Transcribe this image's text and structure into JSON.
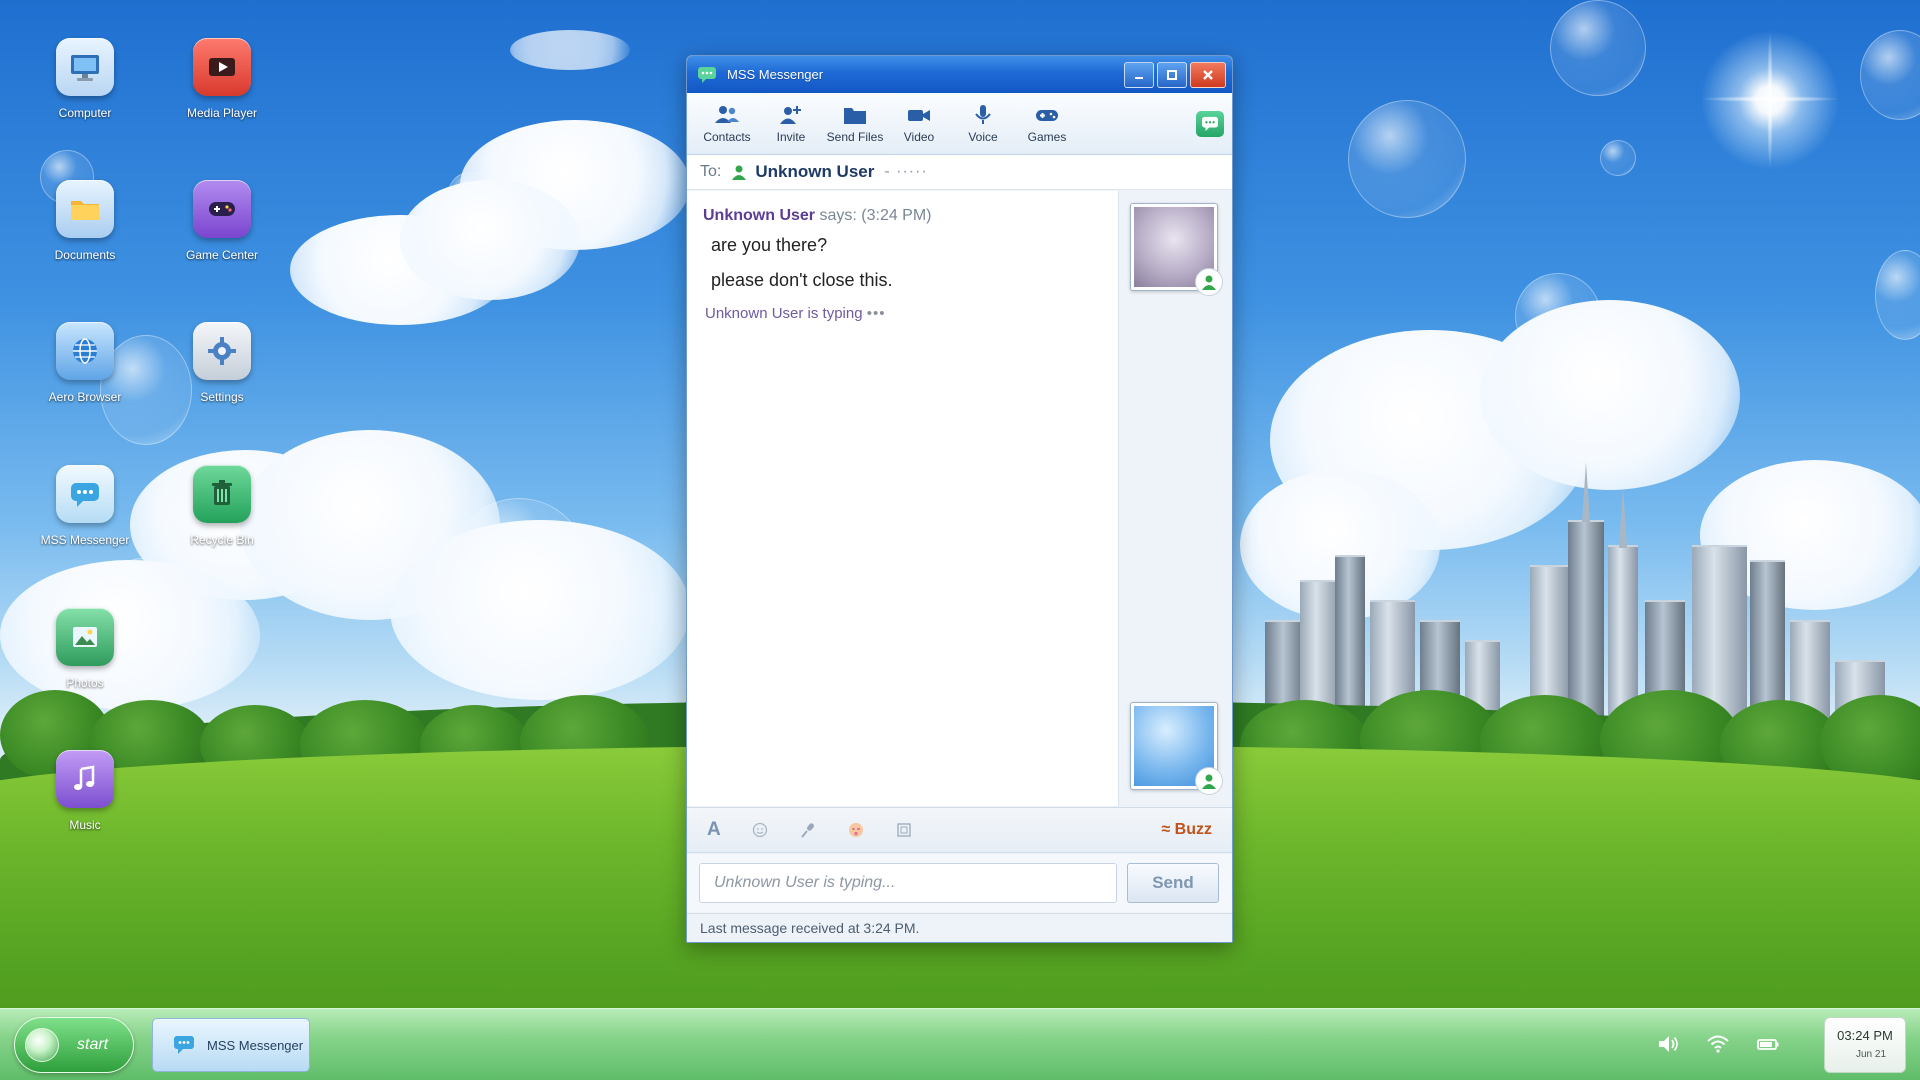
{
  "desktop": {
    "icons": [
      {
        "label": "Computer",
        "icon": "computer-icon"
      },
      {
        "label": "Media Player",
        "icon": "media-player-icon"
      },
      {
        "label": "Documents",
        "icon": "folder-icon"
      },
      {
        "label": "Game Center",
        "icon": "gamepad-icon"
      },
      {
        "label": "Aero Browser",
        "icon": "globe-icon"
      },
      {
        "label": "Settings",
        "icon": "gear-icon"
      },
      {
        "label": "MSS Messenger",
        "icon": "chat-icon"
      },
      {
        "label": "Recycle Bin",
        "icon": "trash-icon"
      },
      {
        "label": "Photos",
        "icon": "photo-icon"
      },
      {
        "label": "Music",
        "icon": "music-note-icon"
      }
    ]
  },
  "window": {
    "title": "MSS Messenger",
    "toolbar": [
      {
        "label": "Contacts",
        "icon": "contacts-icon"
      },
      {
        "label": "Invite",
        "icon": "invite-user-icon"
      },
      {
        "label": "Send Files",
        "icon": "folder-icon"
      },
      {
        "label": "Video",
        "icon": "video-camera-icon"
      },
      {
        "label": "Voice",
        "icon": "microphone-icon"
      },
      {
        "label": "Games",
        "icon": "gamepad-icon"
      }
    ],
    "to": {
      "label": "To:",
      "name": "Unknown User",
      "extra": "- ·····"
    },
    "conversation": {
      "sender": "Unknown User",
      "says": "says:",
      "time": "(3:24 PM)",
      "messages": [
        "are you there?",
        "please don't close this."
      ],
      "typing_text": "Unknown User is typing",
      "typing_dots": "•••"
    },
    "format_tools": {
      "font": "A",
      "buzz": "≈ Buzz"
    },
    "input": {
      "placeholder": "Unknown User is typing...",
      "value": ""
    },
    "send_label": "Send",
    "status": "Last message received at 3:24 PM."
  },
  "taskbar": {
    "start_label": "start",
    "task_item": "MSS Messenger",
    "clock_time": "03:24 PM",
    "clock_date": "Jun 21"
  },
  "colors": {
    "titlebar": "#1e6ad6",
    "sender": "#5b3d96",
    "buzz": "#c0531c",
    "taskbar": "#86d38a"
  }
}
